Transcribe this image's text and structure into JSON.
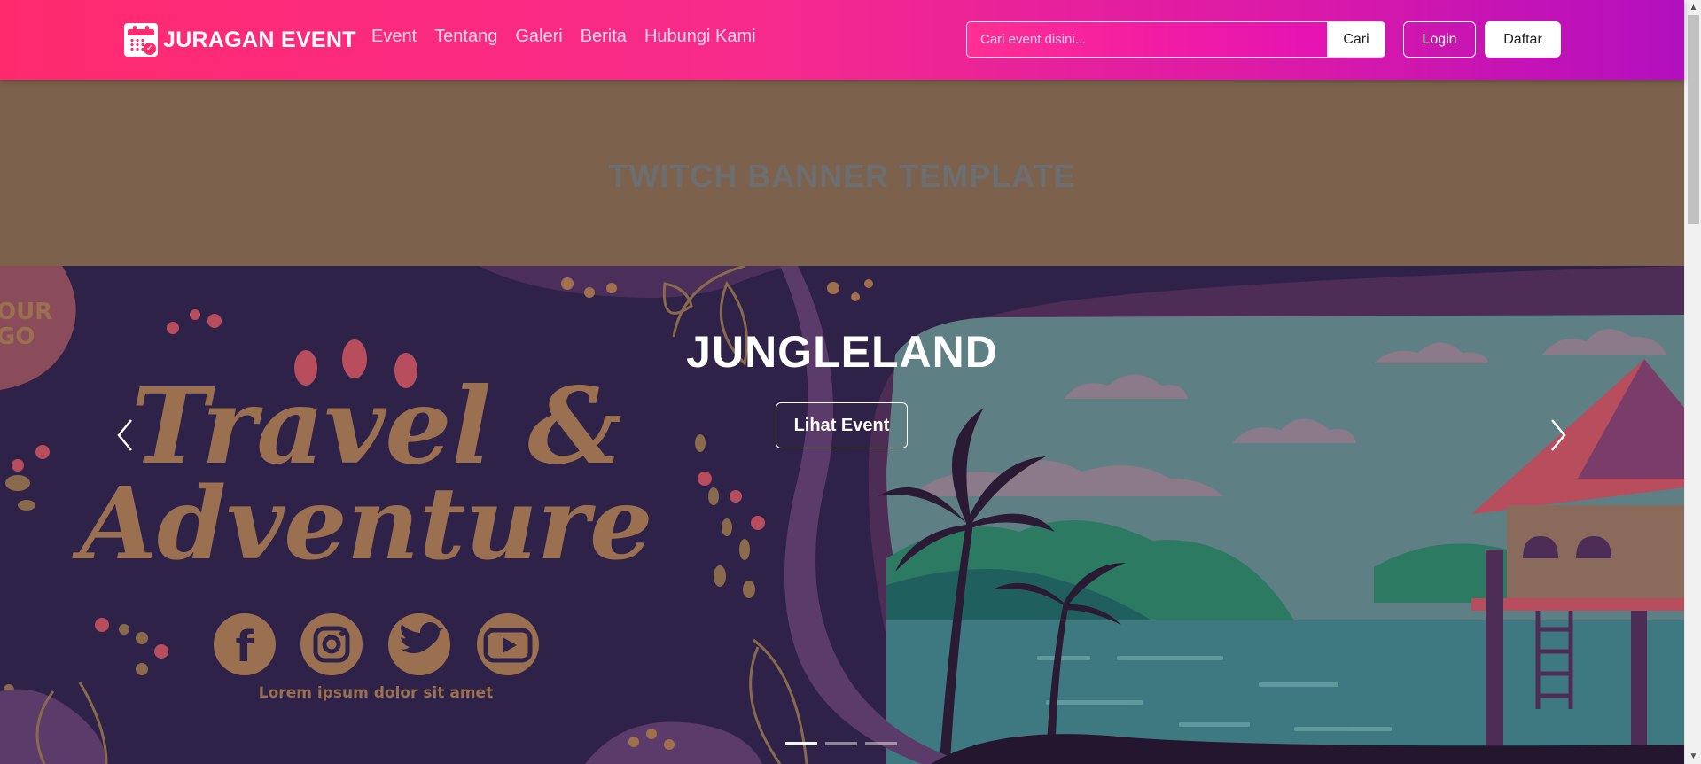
{
  "navbar": {
    "brand": "JURAGAN EVENT",
    "links": [
      "Event",
      "Tentang",
      "Galeri",
      "Berita",
      "Hubungi Kami"
    ],
    "search_placeholder": "Cari event disini...",
    "search_button": "Cari",
    "login": "Login",
    "daftar": "Daftar",
    "colors": {
      "gradient_start": "#ff2a6e",
      "gradient_end": "#b30fbf"
    }
  },
  "carousel": {
    "banner_text": "TWITCH BANNER TEMPLATE",
    "slide_title": "JUNGLELAND",
    "slide_button": "Lihat Event",
    "indicator_count": 3,
    "active_index": 0,
    "art": {
      "logo_text_1": "OUR",
      "logo_text_2": "GO",
      "headline_1": "Travel &",
      "headline_2": "Adventure",
      "caption": "Lorem ipsum dolor sit amet",
      "social_icons": [
        "facebook-icon",
        "instagram-icon",
        "twitter-icon",
        "youtube-icon"
      ]
    }
  }
}
